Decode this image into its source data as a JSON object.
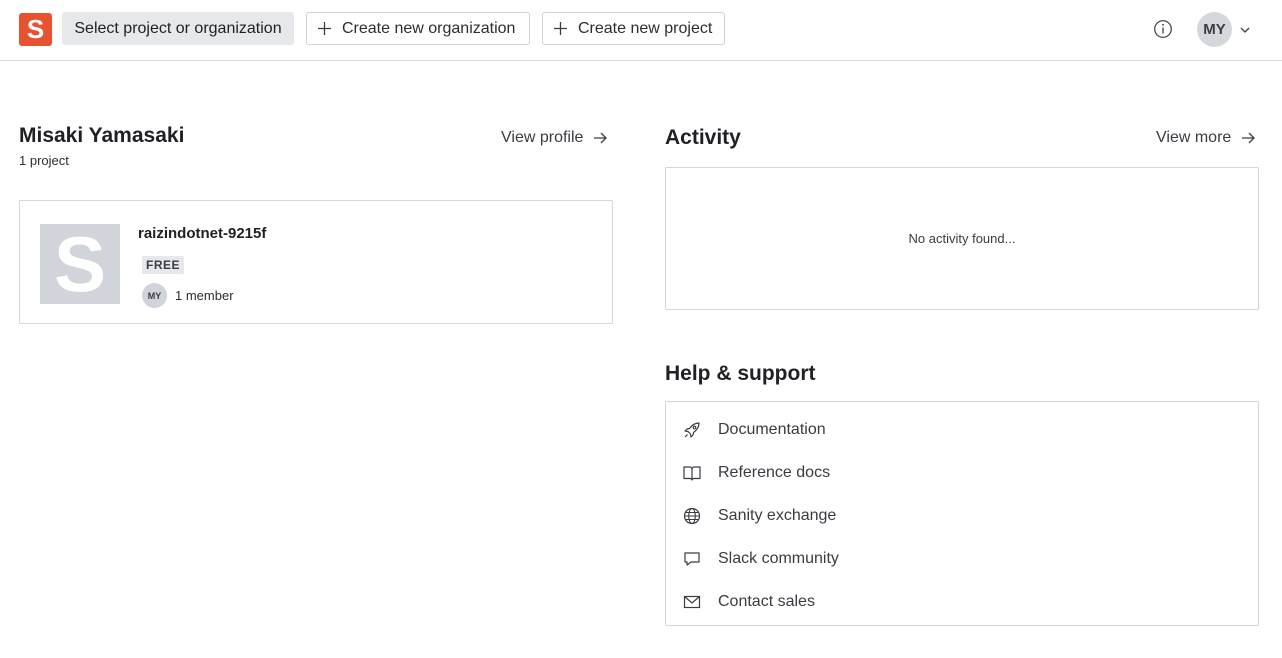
{
  "header": {
    "logo_letter": "S",
    "select_label": "Select project or organization",
    "create_org_label": "Create new organization",
    "create_project_label": "Create new project",
    "avatar_initials": "MY"
  },
  "profile": {
    "name": "Misaki Yamasaki",
    "project_count": "1 project",
    "view_profile_label": "View profile"
  },
  "project": {
    "thumb_letter": "S",
    "name": "raizindotnet-9215f",
    "plan": "FREE",
    "member_initials": "MY",
    "member_count": "1 member"
  },
  "activity": {
    "title": "Activity",
    "view_more_label": "View more",
    "empty_text": "No activity found..."
  },
  "help": {
    "title": "Help & support",
    "items": [
      {
        "label": "Documentation",
        "icon": "rocket-icon"
      },
      {
        "label": "Reference docs",
        "icon": "book-icon"
      },
      {
        "label": "Sanity exchange",
        "icon": "globe-icon"
      },
      {
        "label": "Slack community",
        "icon": "comment-icon"
      },
      {
        "label": "Contact sales",
        "icon": "envelope-icon"
      }
    ]
  },
  "colors": {
    "brand": "#e8532f",
    "border": "#d4d6db",
    "muted_bg": "#e6e8ec"
  }
}
